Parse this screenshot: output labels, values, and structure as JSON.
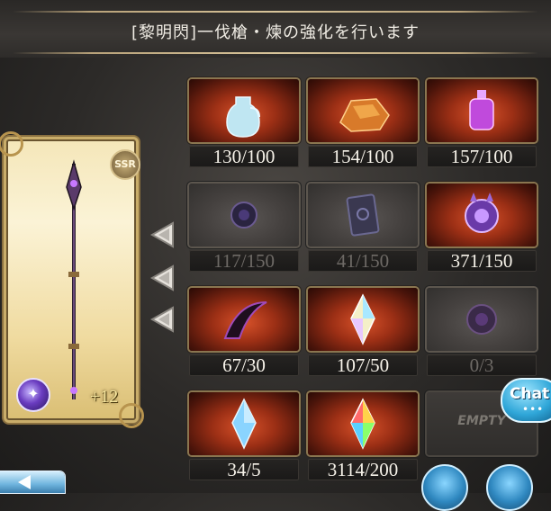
{
  "header": {
    "title": "[黎明閃]一伐槍・煉の強化を行います"
  },
  "weapon": {
    "rarity": "SSR",
    "plus_level": "+12",
    "element_icon": "dark-element-icon"
  },
  "materials": [
    {
      "count": "130/100",
      "icon": "water-jug-icon",
      "active": true
    },
    {
      "count": "154/100",
      "icon": "fire-ore-icon",
      "active": true
    },
    {
      "count": "157/100",
      "icon": "purple-potion-icon",
      "active": true
    },
    {
      "count": "117/150",
      "icon": "dark-orb-icon",
      "active": false
    },
    {
      "count": "41/150",
      "icon": "dark-tome-icon",
      "active": false
    },
    {
      "count": "371/150",
      "icon": "dark-sphere-icon",
      "active": true
    },
    {
      "count": "67/30",
      "icon": "dark-fang-icon",
      "active": true
    },
    {
      "count": "107/50",
      "icon": "prism-crystal-icon",
      "active": true
    },
    {
      "count": "0/3",
      "icon": "dark-core-icon",
      "active": false
    },
    {
      "count": "34/5",
      "icon": "blue-crystal-icon",
      "active": true
    },
    {
      "count": "3114/200",
      "icon": "rainbow-crystal-icon",
      "active": true
    }
  ],
  "empty_slot": {
    "label": "EMPTY"
  },
  "chat": {
    "label": "Chat",
    "dots": "•••"
  },
  "colors": {
    "active_tile": "#b8391c",
    "dim_tile": "#4a4644",
    "count_text": "#f7f3ea",
    "dim_count_text": "#6e6a66",
    "gold_accent": "#c9ad6a"
  }
}
